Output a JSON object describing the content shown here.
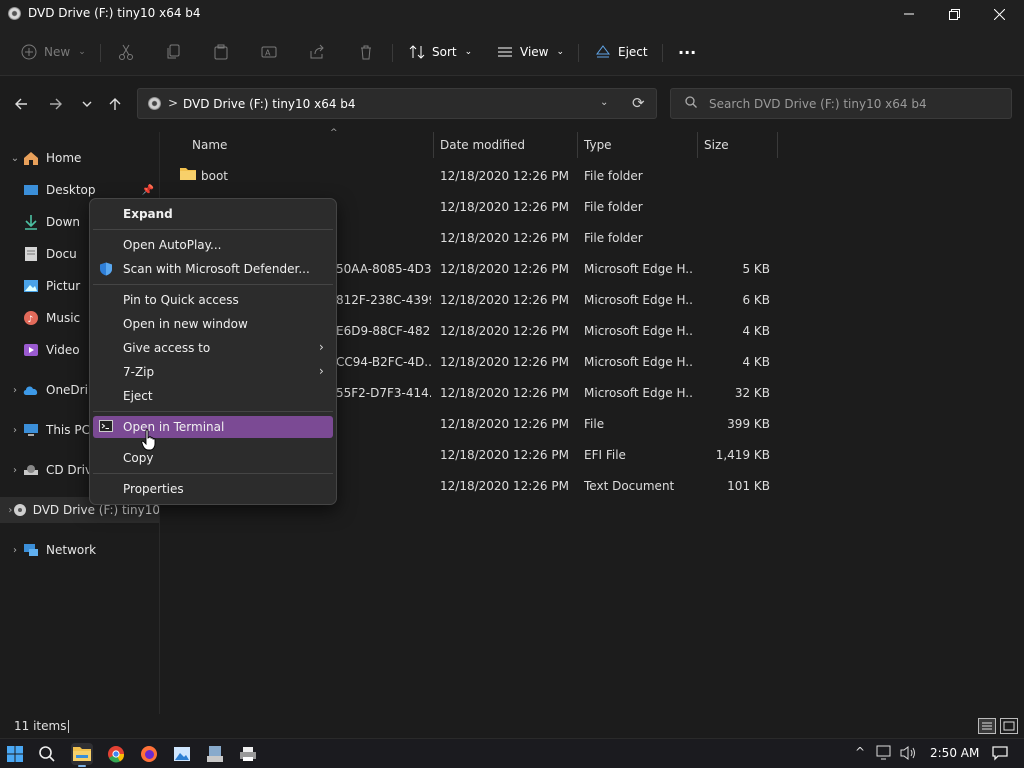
{
  "window": {
    "title": "DVD Drive (F:) tiny10 x64 b4"
  },
  "toolbar": {
    "new_label": "New",
    "sort_label": "Sort",
    "view_label": "View",
    "eject_label": "Eject",
    "more_label": "···"
  },
  "address": {
    "path": "DVD Drive (F:) tiny10 x64 b4",
    "separator": ">"
  },
  "search": {
    "placeholder": "Search DVD Drive (F:) tiny10 x64 b4"
  },
  "nav": {
    "items": [
      {
        "label": "Home"
      },
      {
        "label": "Desktop"
      },
      {
        "label": "Down"
      },
      {
        "label": "Docu"
      },
      {
        "label": "Pictur"
      },
      {
        "label": "Music"
      },
      {
        "label": "Video"
      },
      {
        "label": "OneDri"
      },
      {
        "label": "This PC"
      },
      {
        "label": "CD Driv"
      },
      {
        "label": "DVD Drive (F:) tiny10"
      },
      {
        "label": "Network"
      }
    ]
  },
  "columns": {
    "name": "Name",
    "date": "Date modified",
    "type": "Type",
    "size": "Size"
  },
  "files": [
    {
      "name": "boot",
      "date": "12/18/2020 12:26 PM",
      "type": "File folder",
      "size": ""
    },
    {
      "name": "",
      "date": "12/18/2020 12:26 PM",
      "type": "File folder",
      "size": ""
    },
    {
      "name": "",
      "date": "12/18/2020 12:26 PM",
      "type": "File folder",
      "size": ""
    },
    {
      "name": "50AA-8085-4D3...",
      "date": "12/18/2020 12:26 PM",
      "type": "Microsoft Edge H...",
      "size": "5 KB"
    },
    {
      "name": "812F-238C-4399...",
      "date": "12/18/2020 12:26 PM",
      "type": "Microsoft Edge H...",
      "size": "6 KB"
    },
    {
      "name": "E6D9-88CF-482...",
      "date": "12/18/2020 12:26 PM",
      "type": "Microsoft Edge H...",
      "size": "4 KB"
    },
    {
      "name": "CC94-B2FC-4D...",
      "date": "12/18/2020 12:26 PM",
      "type": "Microsoft Edge H...",
      "size": "4 KB"
    },
    {
      "name": "55F2-D7F3-414...",
      "date": "12/18/2020 12:26 PM",
      "type": "Microsoft Edge H...",
      "size": "32 KB"
    },
    {
      "name": "",
      "date": "12/18/2020 12:26 PM",
      "type": "File",
      "size": "399 KB"
    },
    {
      "name": "",
      "date": "12/18/2020 12:26 PM",
      "type": "EFI File",
      "size": "1,419 KB"
    },
    {
      "name": "",
      "date": "12/18/2020 12:26 PM",
      "type": "Text Document",
      "size": "101 KB"
    }
  ],
  "context_menu": {
    "expand": "Expand",
    "open_autoplay": "Open AutoPlay...",
    "scan_defender": "Scan with Microsoft Defender...",
    "pin_quick_access": "Pin to Quick access",
    "open_new_window": "Open in new window",
    "give_access": "Give access to",
    "seven_zip": "7-Zip",
    "eject": "Eject",
    "open_terminal": "Open in Terminal",
    "copy": "Copy",
    "properties": "Properties"
  },
  "status": {
    "item_count": "11 items"
  },
  "taskbar": {
    "time": "2:50 AM"
  }
}
